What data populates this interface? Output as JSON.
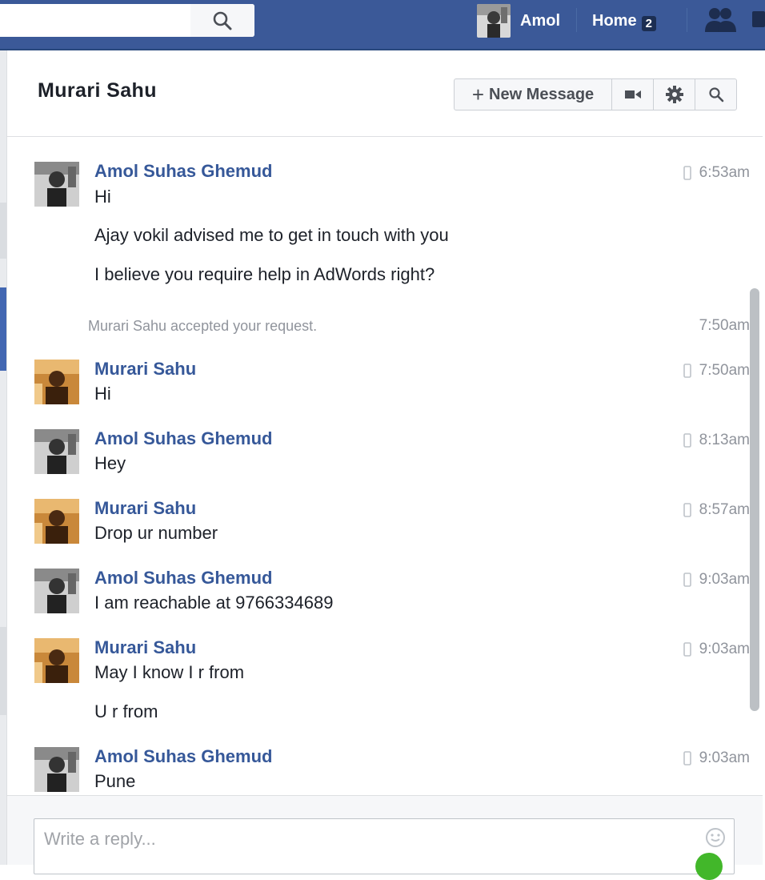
{
  "topbar": {
    "search_placeholder": "",
    "profile_name": "Amol",
    "home_label": "Home",
    "home_badge": "2",
    "icons": {
      "search": "search-icon",
      "friends": "friends-icon",
      "messages": "messages-icon"
    },
    "color": "#3b5998"
  },
  "conversation": {
    "title": "Murari Sahu",
    "new_message_label": "New Message",
    "toolbar_icons": [
      "video-call-icon",
      "gear-icon",
      "search-icon"
    ]
  },
  "messages": [
    {
      "sender": "Amol Suhas Ghemud",
      "avatar": "amol",
      "time": "6:53am",
      "lines": [
        "Hi",
        "Ajay vokil advised me to get in touch with you",
        "I believe you require help in AdWords right?"
      ]
    },
    {
      "system": "Murari Sahu accepted your request.",
      "time": "7:50am"
    },
    {
      "sender": "Murari Sahu",
      "avatar": "murari",
      "time": "7:50am",
      "lines": [
        "Hi"
      ]
    },
    {
      "sender": "Amol Suhas Ghemud",
      "avatar": "amol",
      "time": "8:13am",
      "lines": [
        "Hey"
      ]
    },
    {
      "sender": "Murari Sahu",
      "avatar": "murari",
      "time": "8:57am",
      "lines": [
        "Drop ur number"
      ]
    },
    {
      "sender": "Amol Suhas Ghemud",
      "avatar": "amol",
      "time": "9:03am",
      "lines": [
        "I am reachable at 9766334689"
      ]
    },
    {
      "sender": "Murari Sahu",
      "avatar": "murari",
      "time": "9:03am",
      "lines": [
        "May I know I r from",
        "U r from"
      ]
    },
    {
      "sender": "Amol Suhas Ghemud",
      "avatar": "amol",
      "time": "9:03am",
      "lines": [
        "Pune"
      ]
    }
  ],
  "reply": {
    "placeholder": "Write a reply..."
  },
  "colors": {
    "link": "#365899",
    "meta": "#90949c",
    "accent_green": "#42b72a"
  }
}
